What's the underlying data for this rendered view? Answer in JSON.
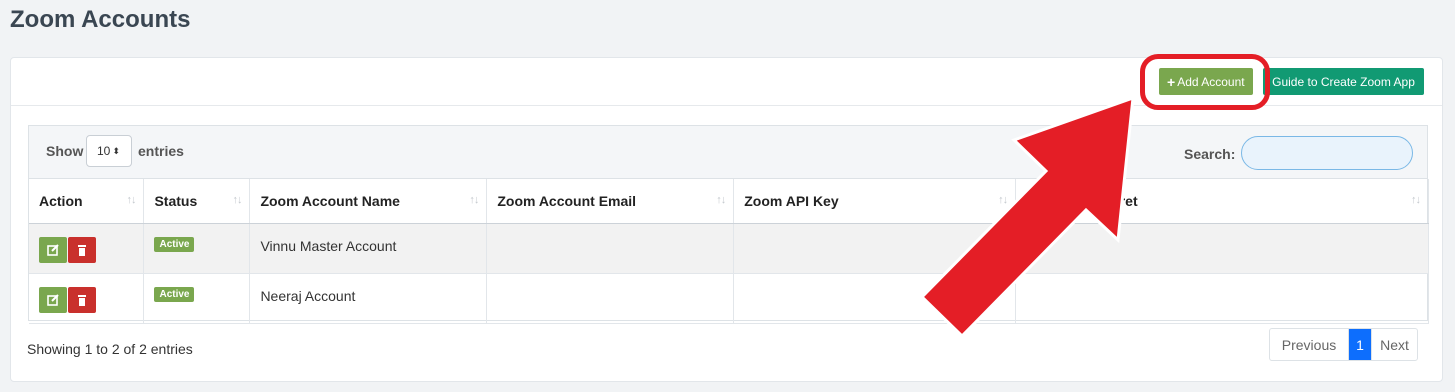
{
  "page": {
    "title": "Zoom Accounts"
  },
  "header": {
    "add_label": "Add Account",
    "guide_label": "Guide to Create Zoom App"
  },
  "table_controls": {
    "show_label": "Show",
    "page_length": "10",
    "entries_label": "entries",
    "search_label": "Search:",
    "search_value": ""
  },
  "table": {
    "columns": [
      "Action",
      "Status",
      "Zoom Account Name",
      "Zoom Account Email",
      "Zoom API Key",
      "Zoom API Secret"
    ],
    "rows": [
      {
        "status": "Active",
        "name": "Vinnu Master Account",
        "email": "",
        "api_key": "",
        "api_secret": ""
      },
      {
        "status": "Active",
        "name": "Neeraj Account",
        "email": "",
        "api_key": "",
        "api_secret": ""
      }
    ]
  },
  "footer": {
    "info": "Showing 1 to 2 of 2 entries",
    "prev_label": "Previous",
    "current_page": "1",
    "next_label": "Next"
  },
  "colors": {
    "accent_green": "#7aa74e",
    "guide_teal": "#119a73",
    "delete_red": "#c9302c",
    "annotation_red": "#e41e26",
    "page_blue": "#0d6efd"
  },
  "icons": {
    "edit": "edit-icon",
    "delete": "trash-icon",
    "sort": "sort-arrows-icon"
  }
}
